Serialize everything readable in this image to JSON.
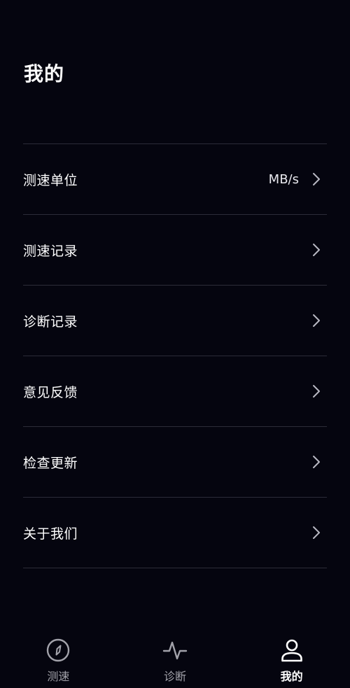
{
  "header": {
    "title": "我的"
  },
  "menu": {
    "items": [
      {
        "label": "测速单位",
        "value": "MB/s"
      },
      {
        "label": "测速记录"
      },
      {
        "label": "诊断记录"
      },
      {
        "label": "意见反馈"
      },
      {
        "label": "检查更新"
      },
      {
        "label": "关于我们"
      }
    ]
  },
  "tabbar": {
    "tabs": [
      {
        "label": "测速",
        "icon": "compass-icon",
        "active": false
      },
      {
        "label": "诊断",
        "icon": "pulse-icon",
        "active": false
      },
      {
        "label": "我的",
        "icon": "user-icon",
        "active": true
      }
    ]
  },
  "colors": {
    "background": "#05050f",
    "divider": "#2c2c38",
    "text": "#ffffff",
    "inactive_tab": "#a2a2aa"
  }
}
